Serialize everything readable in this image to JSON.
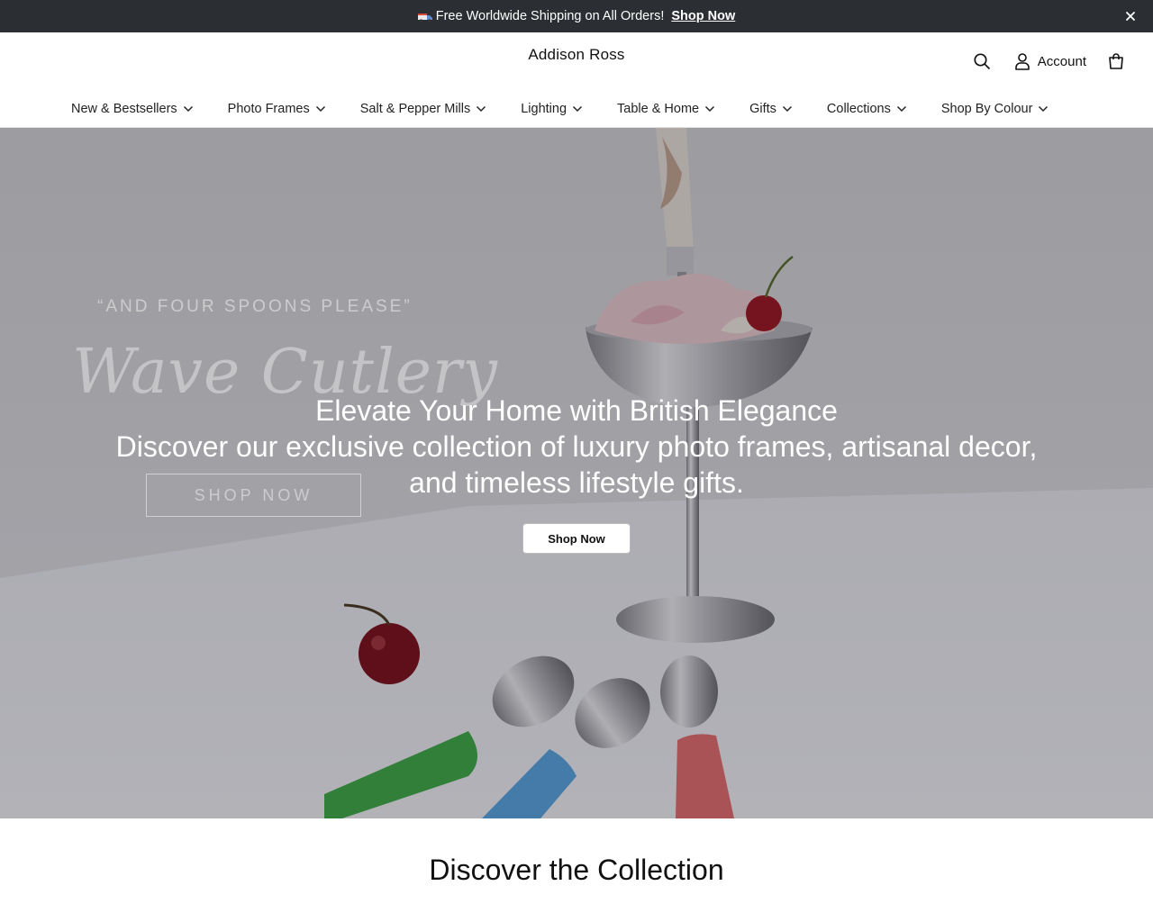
{
  "announcement": {
    "text": "Free Worldwide Shipping on All Orders!",
    "link": "Shop Now",
    "icons": {
      "lead": "delivery-truck-icon",
      "close": "close-icon"
    }
  },
  "header": {
    "brand": "Addison Ross",
    "account_label": "Account",
    "icons": {
      "search": "search-icon",
      "account": "user-icon",
      "cart": "shopping-bag-icon"
    }
  },
  "nav": {
    "items": [
      {
        "label": "New & Bestsellers"
      },
      {
        "label": "Photo Frames"
      },
      {
        "label": "Salt & Pepper Mills"
      },
      {
        "label": "Lighting"
      },
      {
        "label": "Table & Home"
      },
      {
        "label": "Gifts"
      },
      {
        "label": "Collections"
      },
      {
        "label": "Shop By Colour"
      }
    ],
    "item_icon": "chevron-down-icon"
  },
  "hero": {
    "image_overlay": {
      "tagline": "“AND FOUR SPOONS PLEASE”",
      "script": "Wave Cutlery",
      "button": "SHOP NOW"
    },
    "title": "Elevate Your Home with British Elegance",
    "description": "Discover our exclusive collection of luxury photo frames, artisanal decor, and timeless lifestyle gifts.",
    "cta": "Shop Now"
  },
  "section": {
    "title": "Discover the Collection"
  },
  "colors": {
    "announcement_bg": "#2b2f33",
    "text": "#1a1a1a",
    "hero_text": "#ffffff"
  }
}
